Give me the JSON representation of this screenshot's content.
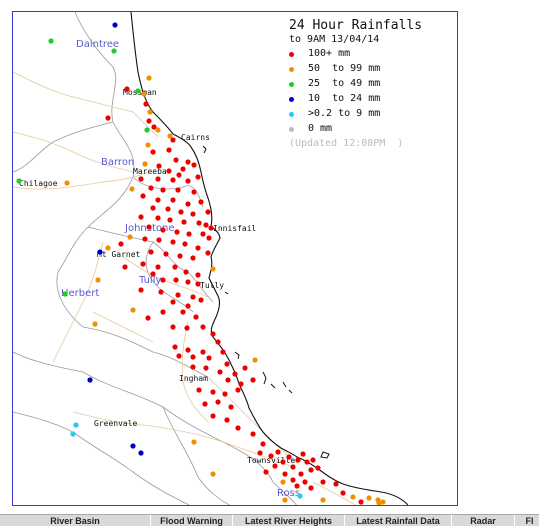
{
  "legend": {
    "title": "24 Hour Rainfalls",
    "subtitle": "to 9AM 13/04/14",
    "items": [
      {
        "label": "100+ mm",
        "color": "#ee0000"
      },
      {
        "label": "50  to 99 mm",
        "color": "#f09000"
      },
      {
        "label": "25  to 49 mm",
        "color": "#22cc22"
      },
      {
        "label": "10  to 24 mm",
        "color": "#0000cc"
      },
      {
        "label": ">0.2 to 9 mm",
        "color": "#22ccee"
      },
      {
        "label": "0 mm",
        "color": "#bbbbbb"
      }
    ],
    "updated": "(Updated 12:08PM  )"
  },
  "places": [
    "Daintree",
    "Mossman",
    "Cairns",
    "Barron",
    "Mareeba",
    "Chilagoe",
    "Johnstone",
    "Innisfail",
    "Mt Garnet",
    "Tully",
    "Tully",
    "Herbert",
    "Ingham",
    "Greenvale",
    "Townsville",
    "Ross"
  ],
  "basins": [
    "Daintree",
    "Barron",
    "Johnstone",
    "Tully",
    "Herbert",
    "Ross"
  ],
  "tabs": [
    "River Basin",
    "Flood Warning",
    "Latest River Heights",
    "Latest Rainfall Data",
    "Radar",
    "Fl"
  ],
  "colors": {
    "red": "#ee0000",
    "orange": "#f09000",
    "green": "#22cc22",
    "blue": "#0000cc",
    "cyan": "#22ccee",
    "grey": "#bbbbbb"
  }
}
